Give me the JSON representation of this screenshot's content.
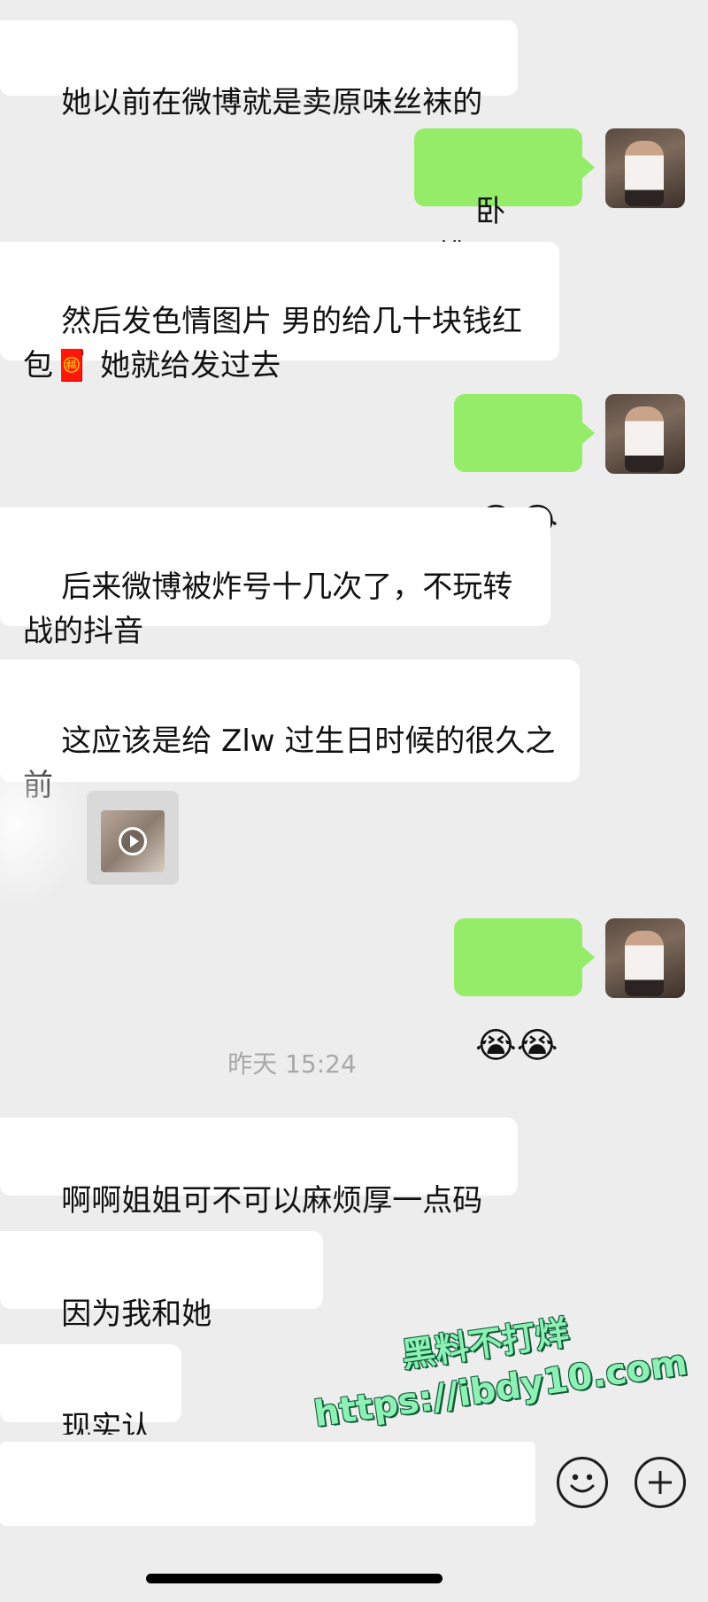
{
  "messages": [
    {
      "side": "left",
      "text": "她以前在微博就是卖原味丝袜的"
    },
    {
      "side": "right",
      "text": "卧槽……"
    },
    {
      "side": "left",
      "text": "然后发色情图片 男的给几十块钱红包🧧 她就给发过去"
    },
    {
      "side": "right",
      "text": "😂😂"
    },
    {
      "side": "left",
      "text": "后来微博被炸号十几次了，不玩转战的抖音"
    },
    {
      "side": "left",
      "text": "这应该是给 Zlw 过生日时候的很久之前"
    },
    {
      "side": "left",
      "type": "video"
    },
    {
      "side": "right",
      "text": "😭😭"
    },
    {
      "side": "left",
      "text": "啊啊姐姐可不可以麻烦厚一点码"
    },
    {
      "side": "left",
      "text": "因为我和她 Emmm"
    },
    {
      "side": "left",
      "text": "现实认识"
    }
  ],
  "timestamp": "昨天 15:24",
  "watermark": {
    "line1": "黑料不打烊",
    "line2": "https://ibdy10.com"
  },
  "input_bar": {
    "emoji_icon": "smiley-face-icon",
    "plus_icon": "plus-icon"
  },
  "colors": {
    "background": "#ededed",
    "left_bubble": "#ffffff",
    "right_bubble": "#95ec69"
  }
}
